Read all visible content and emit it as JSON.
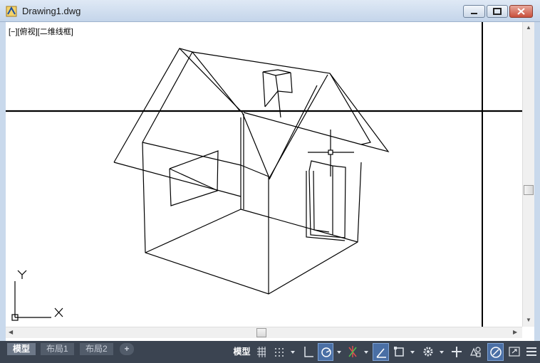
{
  "window": {
    "title": "Drawing1.dwg",
    "controls": [
      "minimize-icon",
      "maximize-icon",
      "close-icon"
    ]
  },
  "viewport": {
    "view_label": "[−][俯视][二维线框]",
    "ucs": {
      "x_label": "X",
      "y_label": "Y"
    }
  },
  "layout_tabs": [
    {
      "label": "模型",
      "active": true
    },
    {
      "label": "布局1",
      "active": false
    },
    {
      "label": "布局2",
      "active": false
    },
    {
      "label": "+",
      "active": false
    }
  ],
  "status_bar": {
    "model_label": "模型",
    "tools": [
      {
        "name": "grid-icon",
        "on": false
      },
      {
        "name": "snap-icon",
        "on": false
      },
      {
        "name": "ortho-icon",
        "on": false
      },
      {
        "name": "polar-icon",
        "on": true
      },
      {
        "name": "isodraft-icon",
        "on": false
      },
      {
        "name": "dynucs-icon",
        "on": true
      },
      {
        "name": "osnap-icon",
        "on": false
      },
      {
        "name": "annotation-icon",
        "on": false
      },
      {
        "name": "add-icon",
        "on": false
      },
      {
        "name": "selection-icon",
        "on": false
      },
      {
        "name": "isolate-icon",
        "on": true
      },
      {
        "name": "fullscreen-icon",
        "on": false
      },
      {
        "name": "menu-icon",
        "on": false
      }
    ]
  },
  "colors": {
    "title_bar": "#c4d5ea",
    "status_bar": "#3b4451",
    "active_tool": "#4a6fa5",
    "drawing_line": "#000000"
  }
}
